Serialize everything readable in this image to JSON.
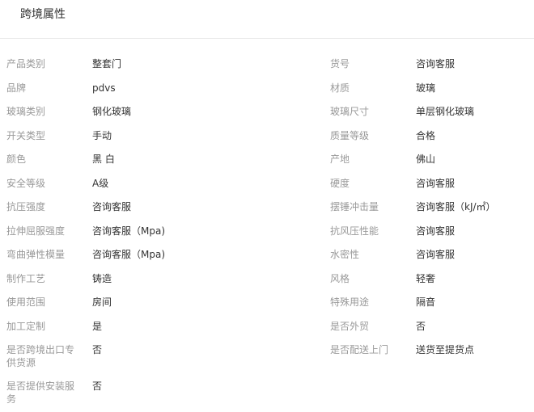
{
  "header": {
    "title": "跨境属性"
  },
  "left_column": [
    {
      "label": "产品类别",
      "value": "整套门"
    },
    {
      "label": "品牌",
      "value": "pdvs"
    },
    {
      "label": "玻璃类别",
      "value": "钢化玻璃"
    },
    {
      "label": "开关类型",
      "value": "手动"
    },
    {
      "label": "颜色",
      "value": "黑 白"
    },
    {
      "label": "安全等级",
      "value": "A级"
    },
    {
      "label": "抗压强度",
      "value": "咨询客服"
    },
    {
      "label": "拉伸屈服强度",
      "value": "咨询客服（Mpa)"
    },
    {
      "label": "弯曲弹性模量",
      "value": "咨询客服（Mpa)"
    },
    {
      "label": "制作工艺",
      "value": "铸造"
    },
    {
      "label": "使用范围",
      "value": "房间"
    },
    {
      "label": "加工定制",
      "value": "是"
    },
    {
      "label": "是否跨境出口专供货源",
      "value": "否"
    },
    {
      "label": "是否提供安装服务",
      "value": "否"
    }
  ],
  "right_column": [
    {
      "label": "货号",
      "value": "咨询客服"
    },
    {
      "label": "材质",
      "value": "玻璃"
    },
    {
      "label": "玻璃尺寸",
      "value": "单层钢化玻璃"
    },
    {
      "label": "质量等级",
      "value": "合格"
    },
    {
      "label": "产地",
      "value": "佛山"
    },
    {
      "label": "硬度",
      "value": "咨询客服"
    },
    {
      "label": "摆锤冲击量",
      "value": "咨询客服（kJ/㎡）"
    },
    {
      "label": "抗风压性能",
      "value": "咨询客服"
    },
    {
      "label": "水密性",
      "value": "咨询客服"
    },
    {
      "label": "风格",
      "value": "轻奢"
    },
    {
      "label": "特殊用途",
      "value": "隔音"
    },
    {
      "label": "是否外贸",
      "value": "否"
    },
    {
      "label": "是否配送上门",
      "value": "送货至提货点"
    }
  ]
}
